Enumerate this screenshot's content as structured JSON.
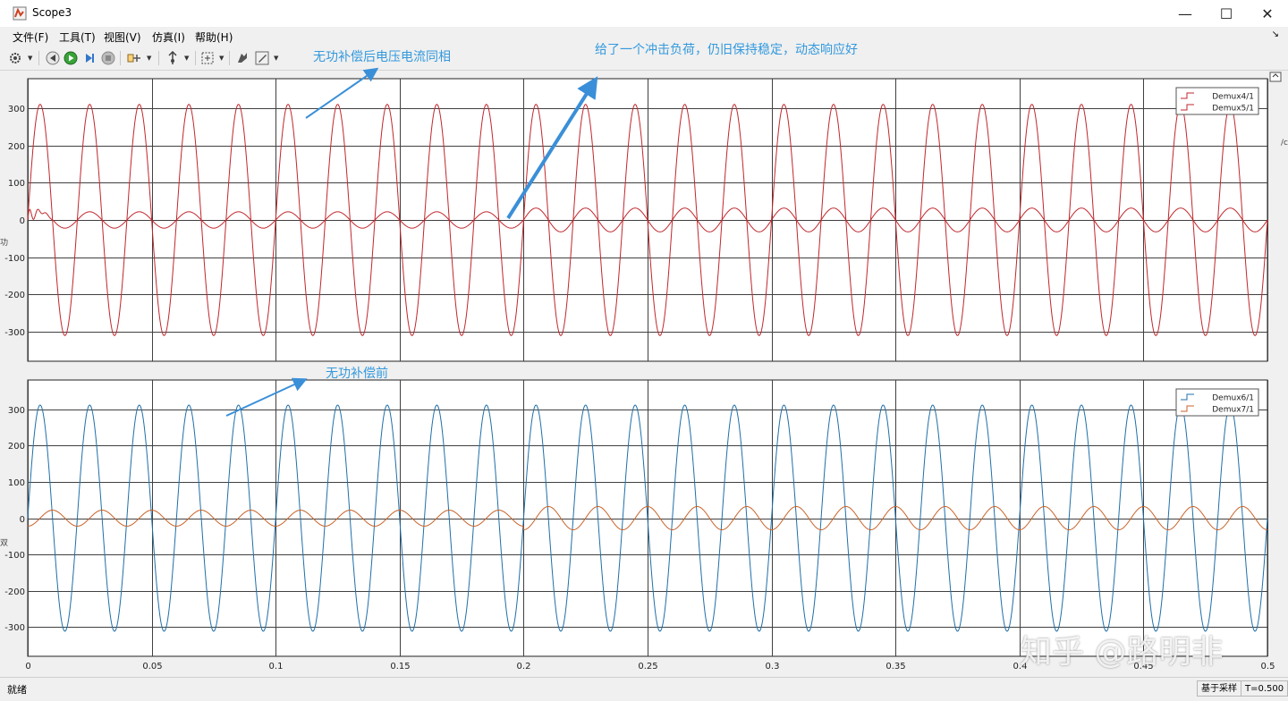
{
  "window": {
    "title": "Scope3",
    "minimize_glyph": "—",
    "maximize_glyph": "☐",
    "close_glyph": "✕"
  },
  "menu": {
    "items": [
      "文件(F)",
      "工具(T)",
      "视图(V)",
      "仿真(I)",
      "帮助(H)"
    ],
    "expand_glyph": "↘"
  },
  "toolbar": {
    "icons": [
      "gear-icon",
      "step-back-icon",
      "run-icon",
      "step-forward-icon",
      "stop-icon",
      "signal-selector-icon",
      "cursor-icon",
      "zoom-fit-icon",
      "highlight-icon",
      "edit-style-icon"
    ]
  },
  "annotations": {
    "top_left": "无功补偿后电压电流同相",
    "top_right": "给了一个冲击负荷，仍旧保持稳定，动态响应好",
    "bottom": "无功补偿前"
  },
  "status": {
    "left": "就绪",
    "sampling": "基于采样",
    "time": "T=0.500"
  },
  "watermark": "知乎 @路明非",
  "colors": {
    "accent": "#3399dd",
    "voltage_top": "#c0272d",
    "current_top": "#c0272d",
    "voltage_bottom": "#1f6fa8",
    "current_bottom": "#c8632a",
    "plot_bg": "#ffffff",
    "grid": "#404040"
  },
  "chart_data": [
    {
      "type": "line",
      "title": "",
      "xlim": [
        0,
        0.5
      ],
      "ylim": [
        -380,
        380
      ],
      "yticks": [
        300,
        200,
        100,
        0,
        -100,
        -200,
        -300
      ],
      "xticks": [
        0,
        0.05,
        0.1,
        0.15,
        0.2,
        0.25,
        0.3,
        0.35,
        0.4,
        0.45,
        0.5
      ],
      "legend": "top-right",
      "series": [
        {
          "name": "Demux4/1",
          "kind": "sine",
          "amplitude": 311,
          "frequency_hz": 50,
          "phase_deg": 0
        },
        {
          "name": "Demux5/1",
          "kind": "sine",
          "amplitude_before": 22,
          "amplitude_after": 32,
          "step_time": 0.2,
          "frequency_hz": 50,
          "phase_deg": 0
        }
      ]
    },
    {
      "type": "line",
      "title": "",
      "xlim": [
        0,
        0.5
      ],
      "ylim": [
        -380,
        380
      ],
      "yticks": [
        300,
        200,
        100,
        0,
        -100,
        -200,
        -300
      ],
      "xticks": [
        0,
        0.05,
        0.1,
        0.15,
        0.2,
        0.25,
        0.3,
        0.35,
        0.4,
        0.45,
        0.5
      ],
      "xtick_labels": [
        "0",
        "0.05",
        "0.1",
        "0.15",
        "0.2",
        "0.25",
        "0.3",
        "0.35",
        "0.4",
        "0.45",
        "0.5"
      ],
      "legend": "top-right",
      "series": [
        {
          "name": "Demux6/1",
          "kind": "sine",
          "amplitude": 311,
          "frequency_hz": 50,
          "phase_deg": 0
        },
        {
          "name": "Demux7/1",
          "kind": "sine",
          "amplitude_before": 22,
          "amplitude_after": 32,
          "step_time": 0.2,
          "frequency_hz": 50,
          "phase_deg": -90
        }
      ]
    }
  ]
}
